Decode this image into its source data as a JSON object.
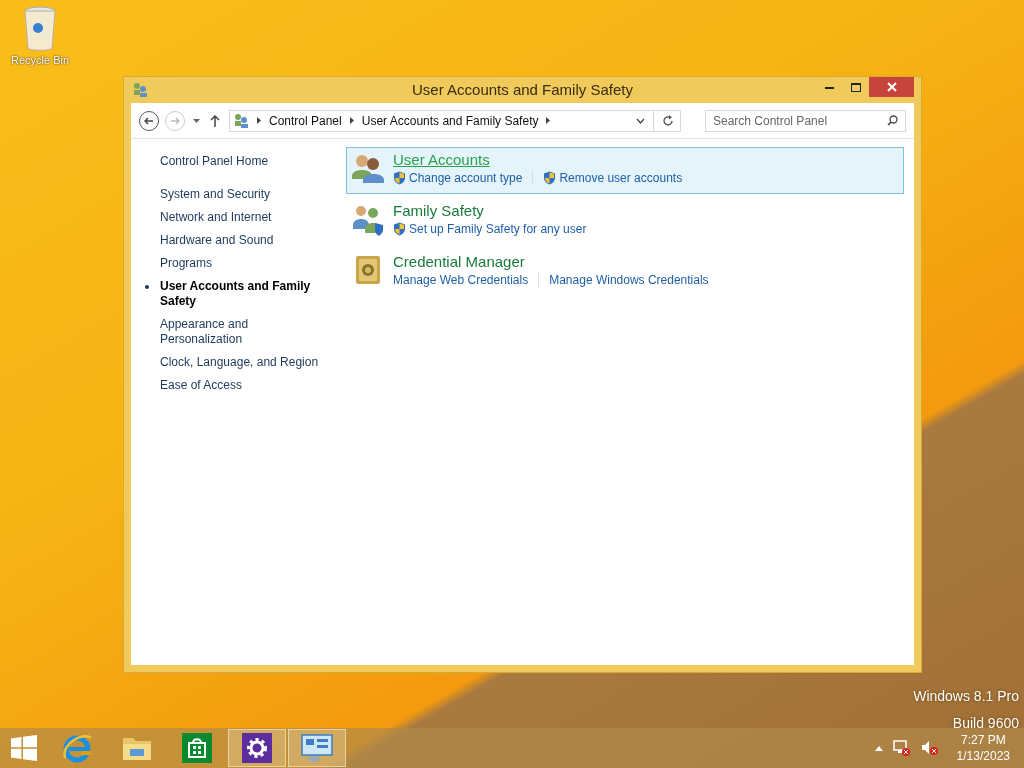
{
  "desktop": {
    "icons": [
      {
        "label": "Recycle Bin"
      }
    ],
    "watermark": [
      "Windows 8.1 Pro",
      "Build 9600"
    ]
  },
  "window": {
    "title": "User Accounts and Family Safety",
    "breadcrumb": [
      "Control Panel",
      "User Accounts and Family Safety"
    ],
    "search": {
      "placeholder": "Search Control Panel"
    },
    "sidebar": {
      "home": "Control Panel Home",
      "items": [
        {
          "label": "System and Security",
          "selected": false
        },
        {
          "label": "Network and Internet",
          "selected": false
        },
        {
          "label": "Hardware and Sound",
          "selected": false
        },
        {
          "label": "Programs",
          "selected": false
        },
        {
          "label": "User Accounts and Family Safety",
          "selected": true
        },
        {
          "label": "Appearance and Personalization",
          "selected": false
        },
        {
          "label": "Clock, Language, and Region",
          "selected": false
        },
        {
          "label": "Ease of Access",
          "selected": false
        }
      ]
    },
    "categories": [
      {
        "kind": "users",
        "title": "User Accounts",
        "highlighted": true,
        "tasks": [
          {
            "label": "Change account type",
            "shield": true
          },
          {
            "label": "Remove user accounts",
            "shield": true
          }
        ]
      },
      {
        "kind": "family",
        "title": "Family Safety",
        "highlighted": false,
        "tasks": [
          {
            "label": "Set up Family Safety for any user",
            "shield": true
          }
        ]
      },
      {
        "kind": "safe",
        "title": "Credential Manager",
        "highlighted": false,
        "tasks": [
          {
            "label": "Manage Web Credentials",
            "shield": false
          },
          {
            "label": "Manage Windows Credentials",
            "shield": false
          }
        ]
      }
    ]
  },
  "taskbar": {
    "buttons": [
      {
        "kind": "ie",
        "active": false
      },
      {
        "kind": "explorer",
        "active": false
      },
      {
        "kind": "store",
        "active": false
      },
      {
        "kind": "settings",
        "active": true
      },
      {
        "kind": "controlpanel",
        "active": true
      }
    ],
    "time": "7:27 PM",
    "date": "1/13/2023"
  }
}
